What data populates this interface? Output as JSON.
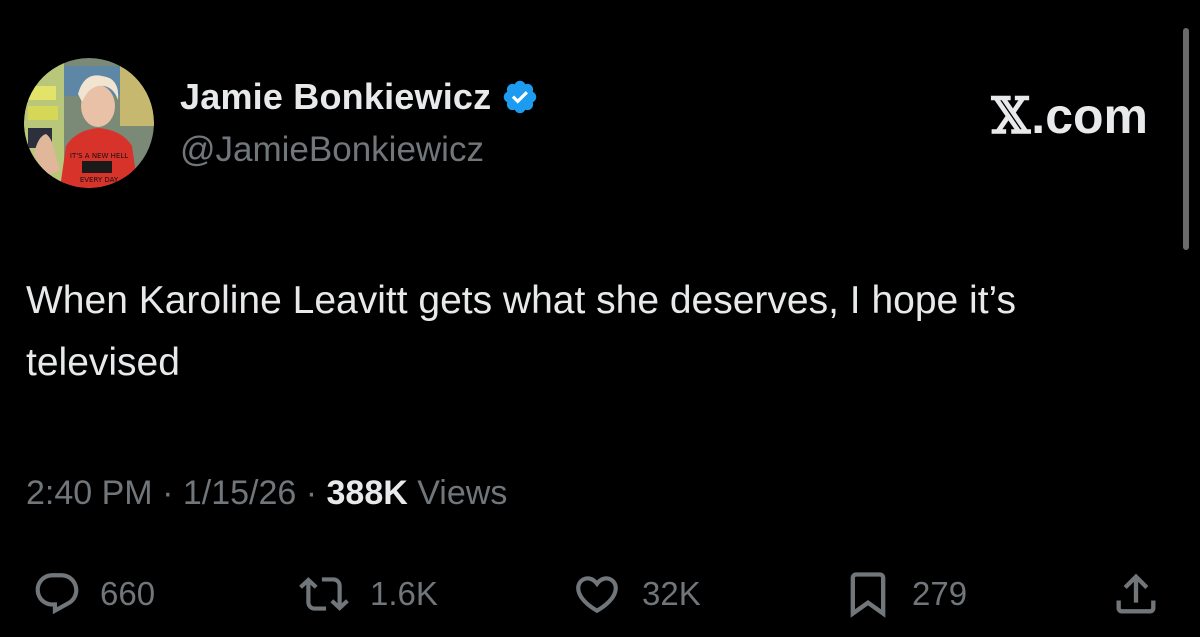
{
  "author": {
    "display_name": "Jamie Bonkiewicz",
    "handle": "@JamieBonkiewicz",
    "verified": true,
    "verified_color": "#1d9bf0",
    "avatar_icon": "profile-photo",
    "shirt_text_top": "IT'S A NEW HELL",
    "shirt_text_bottom": "EVERY DAY"
  },
  "brand": {
    "x": "𝕏",
    "suffix": ".com"
  },
  "tweet": {
    "text": "When Karoline Leavitt gets what she deserves, I hope it’s televised"
  },
  "meta": {
    "time": "2:40 PM",
    "sep1": " · ",
    "date": "1/15/26",
    "sep2": " · ",
    "views_count": "388K",
    "views_label": " Views"
  },
  "actions": {
    "replies": {
      "icon": "reply-icon",
      "count": "660"
    },
    "reposts": {
      "icon": "repost-icon",
      "count": "1.6K"
    },
    "likes": {
      "icon": "heart-icon",
      "count": "32K"
    },
    "bookmarks": {
      "icon": "bookmark-icon",
      "count": "279"
    },
    "share": {
      "icon": "share-icon"
    }
  },
  "colors": {
    "background": "#000000",
    "text_primary": "#e7e9ea",
    "text_secondary": "#71767b"
  }
}
